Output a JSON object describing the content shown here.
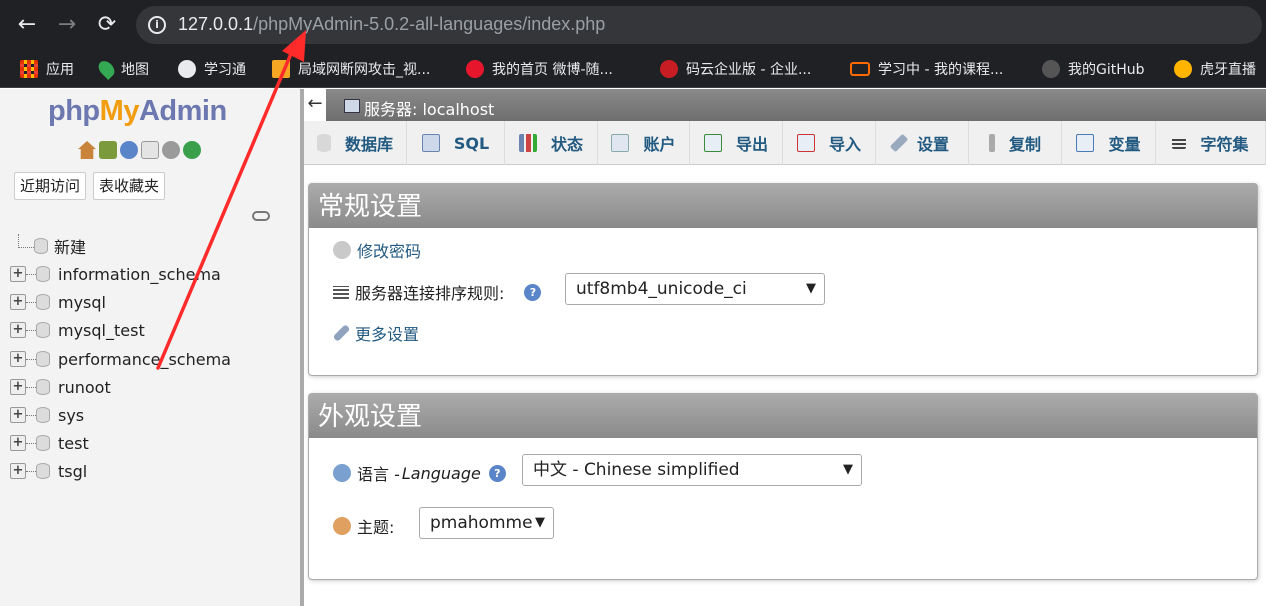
{
  "browser": {
    "back": "←",
    "forward": "→",
    "reload": "⟳",
    "url_host": "127.0.0.1",
    "url_path": "/phpMyAdmin-5.0.2-all-languages/index.php",
    "bookmarks": [
      {
        "label": "应用",
        "icon": "apps-grid-icon",
        "color": "#ea4335"
      },
      {
        "label": "地图",
        "icon": "maps-pin-icon",
        "color": "#34a853"
      },
      {
        "label": "学习通",
        "icon": "globe-icon",
        "color": "#e8eaed"
      },
      {
        "label": "局域网断网攻击_视...",
        "icon": "fire-icon",
        "color": "#f5a623"
      },
      {
        "label": "我的首页 微博-随...",
        "icon": "weibo-icon",
        "color": "#e6162d"
      },
      {
        "label": "码云企业版 - 企业...",
        "icon": "gitee-icon",
        "color": "#c71d23"
      },
      {
        "label": "学习中 - 我的课程...",
        "icon": "brackets-icon",
        "color": "#ff6a00"
      },
      {
        "label": "我的GitHub",
        "icon": "github-icon",
        "color": "#333333"
      },
      {
        "label": "虎牙直播",
        "icon": "huya-icon",
        "color": "#ffb400"
      }
    ]
  },
  "nav": {
    "logo": {
      "php": "php",
      "my": "My",
      "admin": "Admin"
    },
    "tabs": [
      "近期访问",
      "表收藏夹"
    ],
    "new_label": "新建",
    "databases": [
      "information_schema",
      "mysql",
      "mysql_test",
      "performance_schema",
      "runoot",
      "sys",
      "test",
      "tsgl"
    ]
  },
  "top": {
    "back": "←",
    "server_label": "服务器: localhost",
    "menu": [
      {
        "label": "数据库",
        "icon": "database-icon"
      },
      {
        "label": "SQL",
        "icon": "sql-icon"
      },
      {
        "label": "状态",
        "icon": "status-chart-icon"
      },
      {
        "label": "账户",
        "icon": "users-icon"
      },
      {
        "label": "导出",
        "icon": "export-icon"
      },
      {
        "label": "导入",
        "icon": "import-icon"
      },
      {
        "label": "设置",
        "icon": "wrench-icon"
      },
      {
        "label": "复制",
        "icon": "replication-icon"
      },
      {
        "label": "变量",
        "icon": "variables-icon"
      },
      {
        "label": "字符集",
        "icon": "charset-icon"
      }
    ]
  },
  "general": {
    "title": "常规设置",
    "change_password": "修改密码",
    "collation_label": "服务器连接排序规则:",
    "collation_value": "utf8mb4_unicode_ci",
    "more_settings": "更多设置"
  },
  "appearance": {
    "title": "外观设置",
    "language_label": "语言 - ",
    "language_label_en": "Language",
    "language_value": "中文 - Chinese simplified",
    "theme_label": "主题:",
    "theme_value": "pmahomme"
  },
  "colors": {
    "link": "#235a81",
    "annotation": "#ff2a2a",
    "brand_orange": "#f29d0f",
    "brand_blue": "#6c78af"
  }
}
